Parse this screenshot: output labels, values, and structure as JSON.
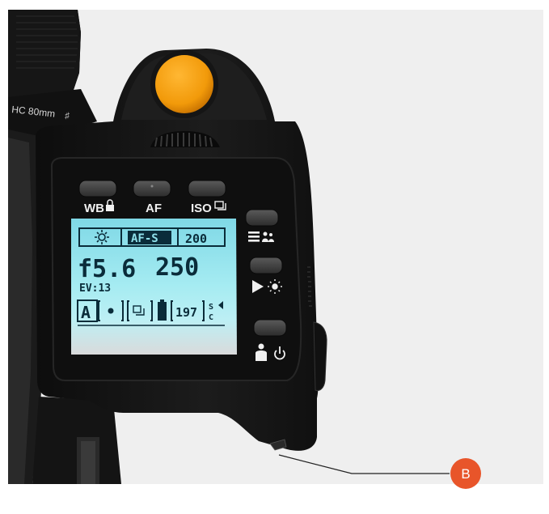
{
  "lens": {
    "label": "HC 80mm",
    "label_suffix": "♯"
  },
  "buttons": {
    "wb": "WB",
    "af": "AF",
    "iso": "ISO"
  },
  "lcd": {
    "white_balance_icon": "sun-icon",
    "af_mode": "AF-S",
    "iso_value": "200",
    "aperture": "f5.6",
    "shutter": "250",
    "ev": "EV:13",
    "mode": "A",
    "shots_remaining": "197",
    "corner_text_top": "S",
    "corner_text_bottom": "C"
  },
  "callout": {
    "label": "B",
    "color": "#e8552a"
  },
  "colors": {
    "shutter_button": "#f29a0a",
    "lcd_background": "#8fe0ea",
    "body": "#1a1a1a"
  }
}
